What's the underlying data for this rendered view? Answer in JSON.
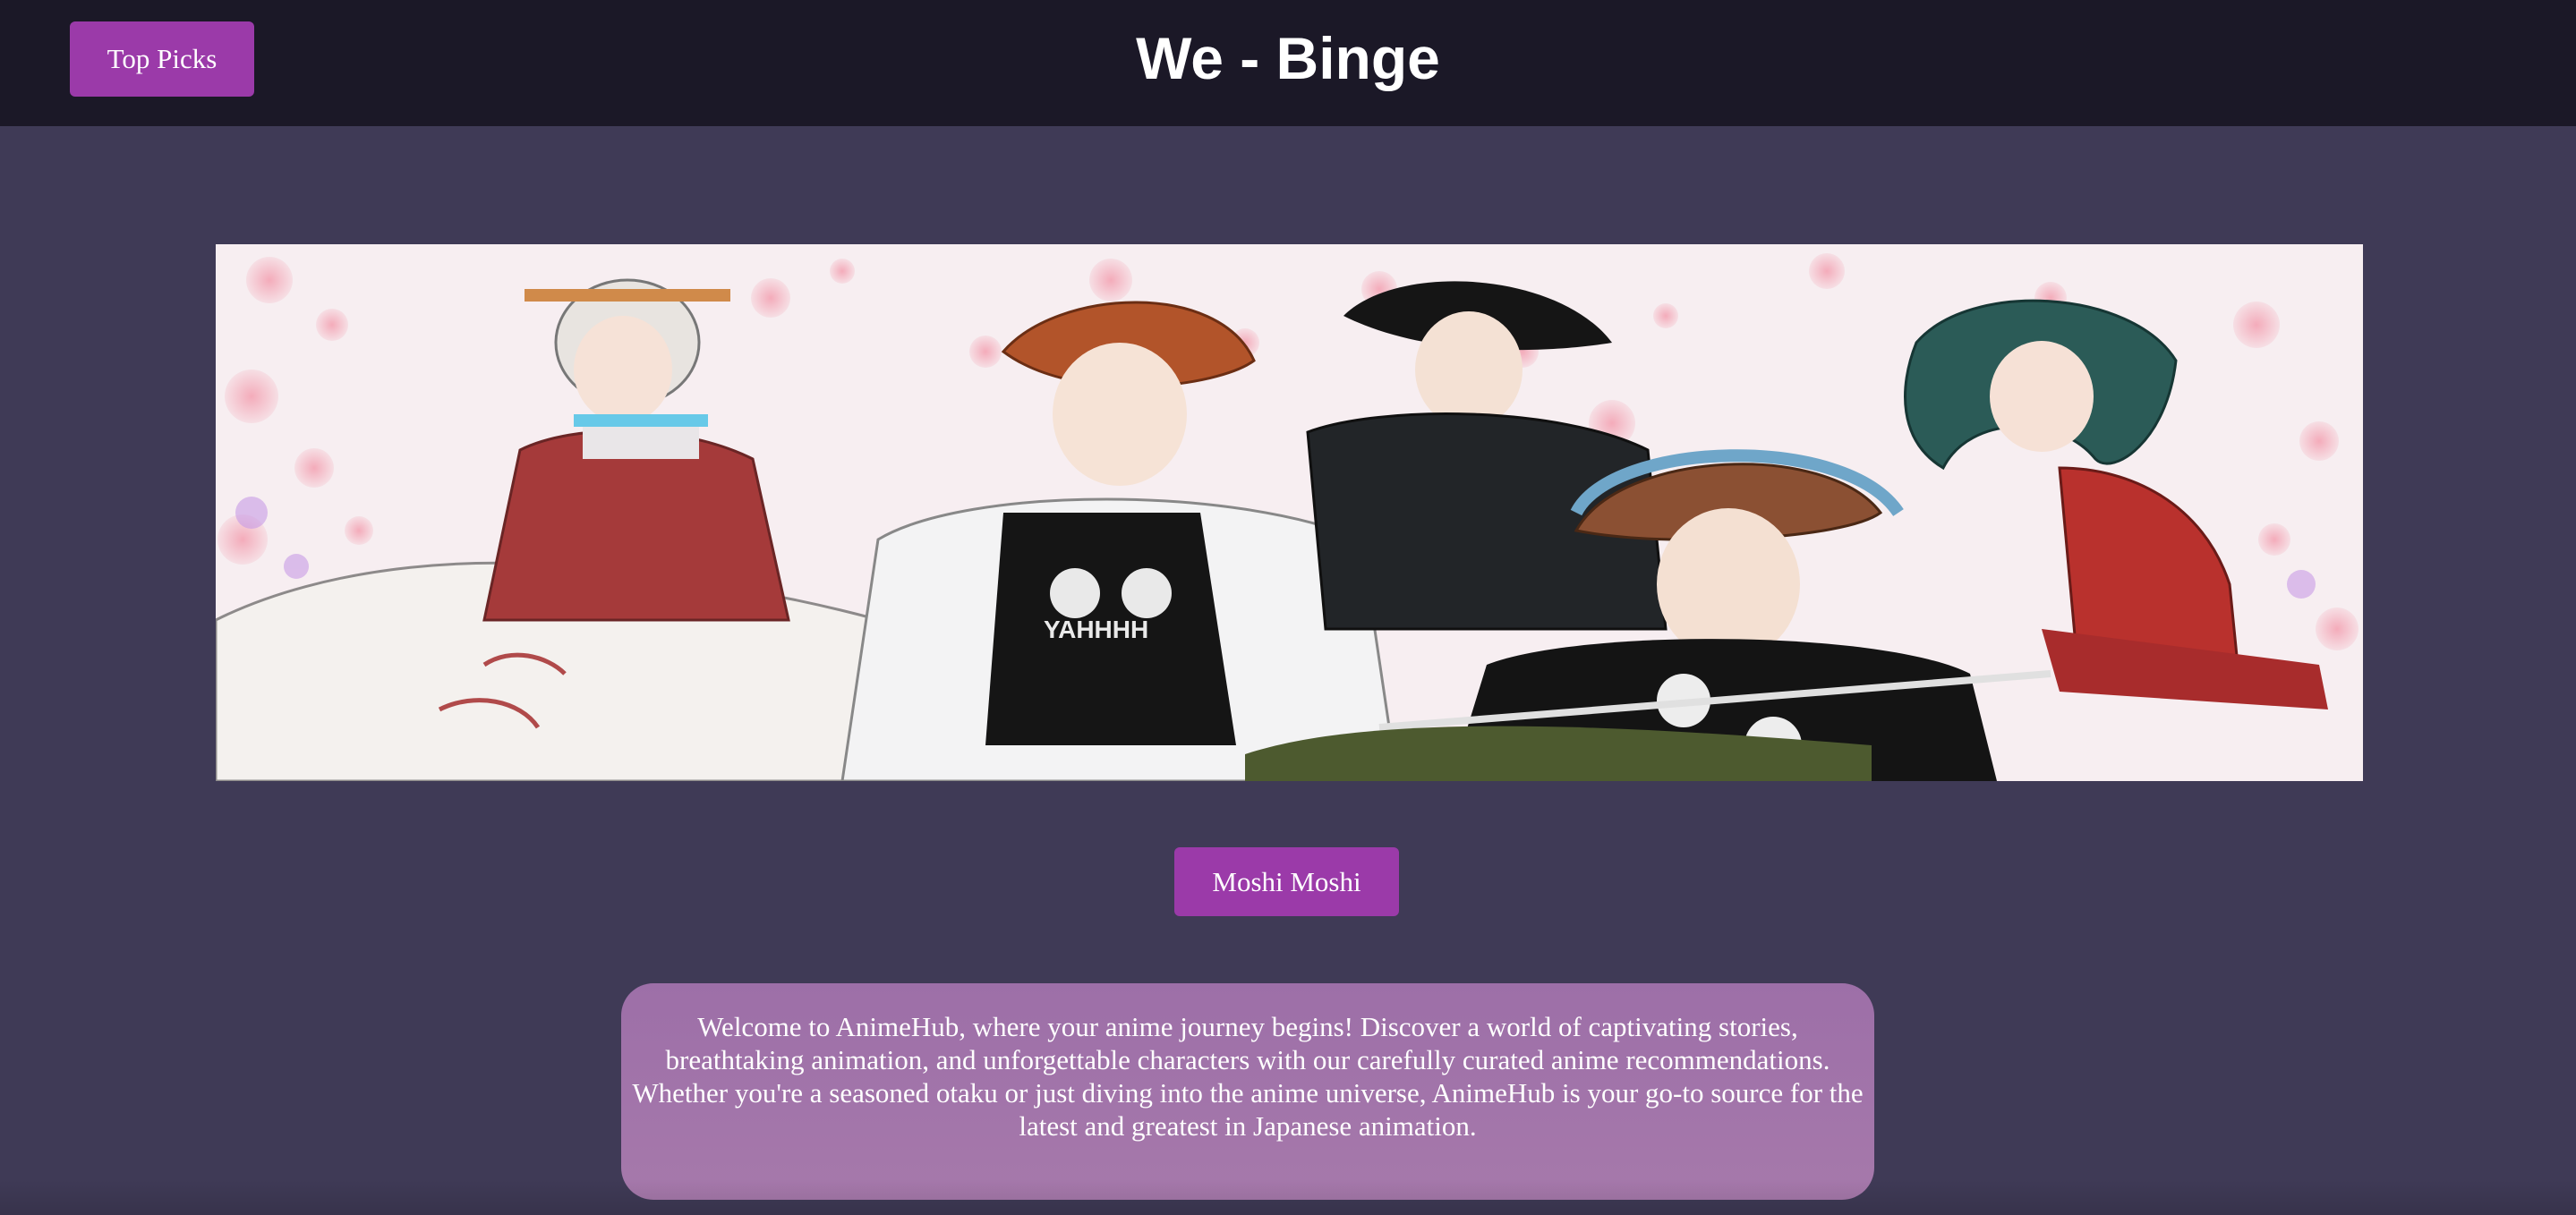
{
  "header": {
    "title": "We - Binge",
    "top_picks_label": "Top Picks"
  },
  "hero": {
    "image_alt": "anime group artwork",
    "shirt_text": "YAHHHH"
  },
  "main": {
    "greeting_button_label": "Moshi Moshi",
    "welcome_text": "Welcome to AnimeHub, where your anime journey begins! Discover a world of captivating stories, breathtaking animation, and unforgettable characters with our carefully curated anime recommendations. Whether you're a seasoned otaku or just diving into the anime universe, AnimeHub is your go-to source for the latest and greatest in Japanese animation."
  },
  "colors": {
    "page_background": "#3f3a56",
    "navbar_background": "#1b1827",
    "button_accent": "#9b3aa9",
    "welcome_card": "#a076aa"
  }
}
